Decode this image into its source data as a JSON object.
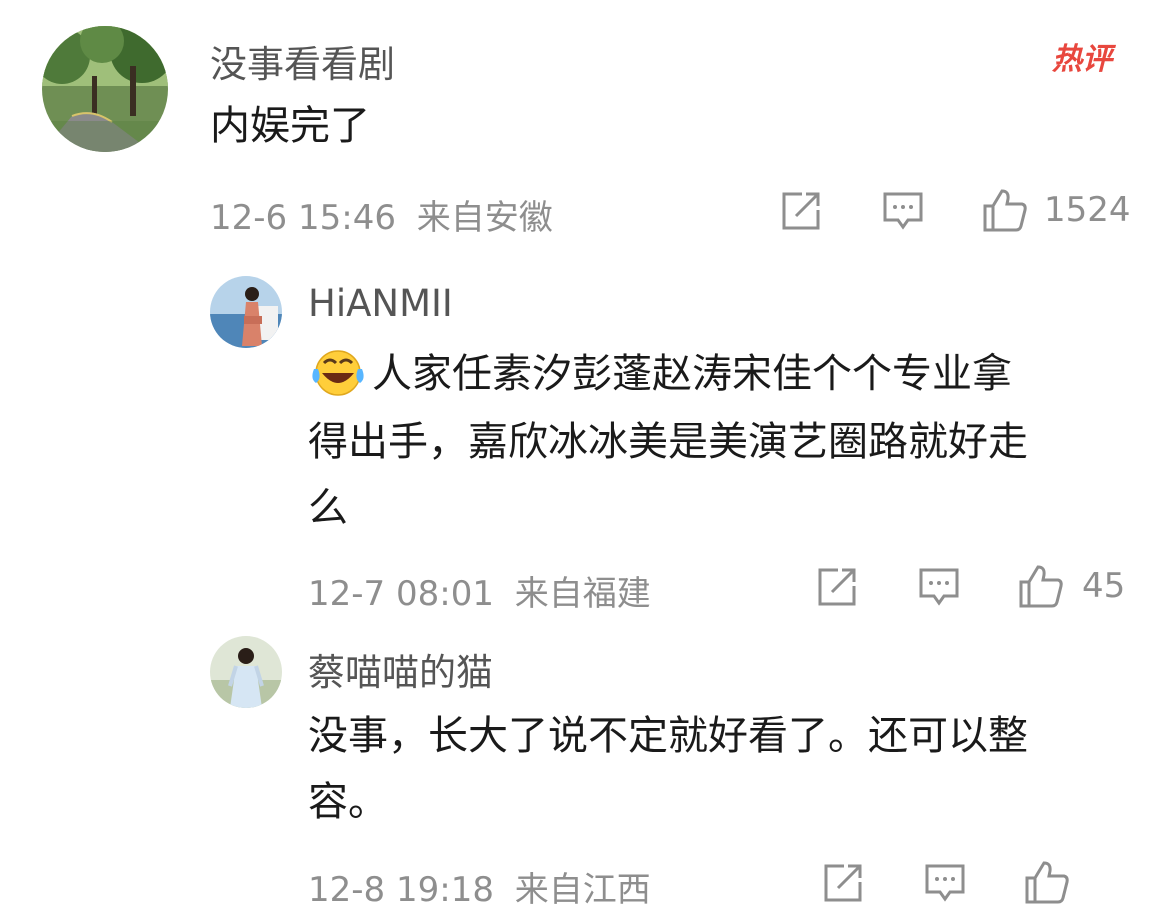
{
  "comments": [
    {
      "username": "没事看看剧",
      "badge": "热评",
      "text": "内娱完了",
      "time": "12-6 15:46",
      "location": "来自安徽",
      "likes": "1524"
    },
    {
      "username": "HiANMII",
      "emoji": "laugh-cry",
      "text_line1": "人家任素汐彭蓬赵涛宋佳个个专业拿",
      "text_line2": "得出手，嘉欣冰冰美是美演艺圈路就好走",
      "text_line3": "么",
      "time": "12-7 08:01",
      "location": "来自福建",
      "likes": "45"
    },
    {
      "username": "蔡喵喵的猫",
      "text_line1": "没事，长大了说不定就好看了。还可以整",
      "text_line2": "容。",
      "time": "12-8 19:18",
      "location": "来自江西"
    }
  ],
  "colors": {
    "badge": "#e8473e",
    "meta": "#8e8e8e",
    "name": "#555555",
    "text": "#1a1a1a"
  }
}
